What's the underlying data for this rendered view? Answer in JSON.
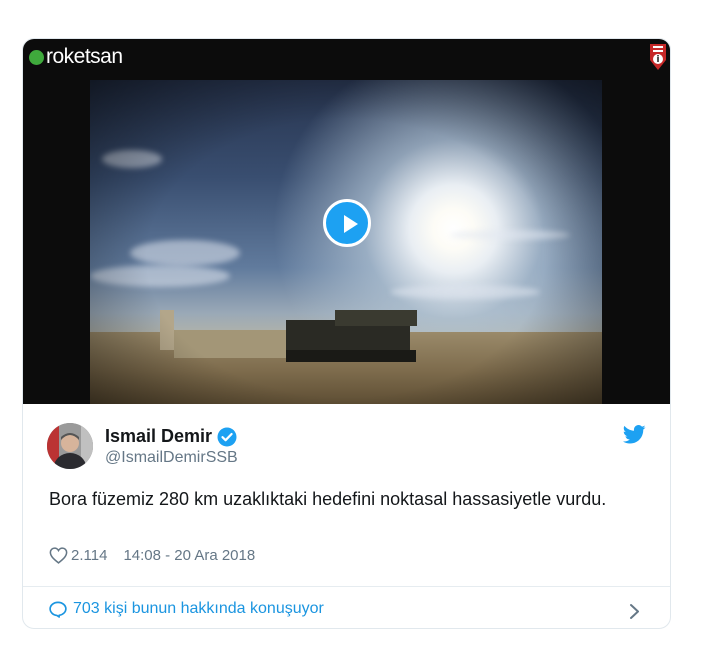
{
  "video": {
    "logo_text": "roketsan",
    "play_icon": "play-icon",
    "colors": {
      "play": "#1da1f2",
      "logo_dot": "#3faa3c"
    }
  },
  "tweet": {
    "author_name": "Ismail Demir",
    "handle": "@IsmailDemirSSB",
    "text": "Bora füzemiz 280 km uzaklıktaki hedefini noktasal hassasiyetle vurdu.",
    "likes": "2.114",
    "timestamp": "14:08 - 20 Ara 2018",
    "reply_prompt": "703 kişi bunun hakkında konuşuyor"
  },
  "colors": {
    "text": "#14171a",
    "muted": "#657786",
    "link": "#1b95e0",
    "border": "#e1e8ed",
    "twitter_blue": "#1da1f2"
  },
  "icons": {
    "verified": "verified-badge-icon",
    "twitter": "twitter-bird-icon",
    "like": "heart-icon",
    "reply": "speech-bubble-icon",
    "chevron": "chevron-right-icon"
  }
}
